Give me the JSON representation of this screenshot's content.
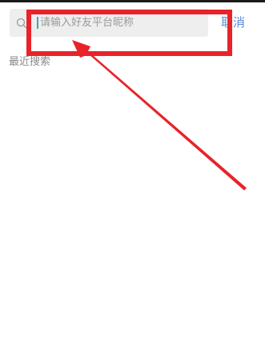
{
  "search": {
    "placeholder": "请输入好友平台昵称",
    "cancel_label": "取消"
  },
  "recent": {
    "title": "最近搜索"
  },
  "icons": {
    "search": "search-icon"
  },
  "colors": {
    "search_bar_bg": "#eeeeee",
    "cancel_text": "#5b8ad6",
    "annotation_red": "#e8232a"
  }
}
